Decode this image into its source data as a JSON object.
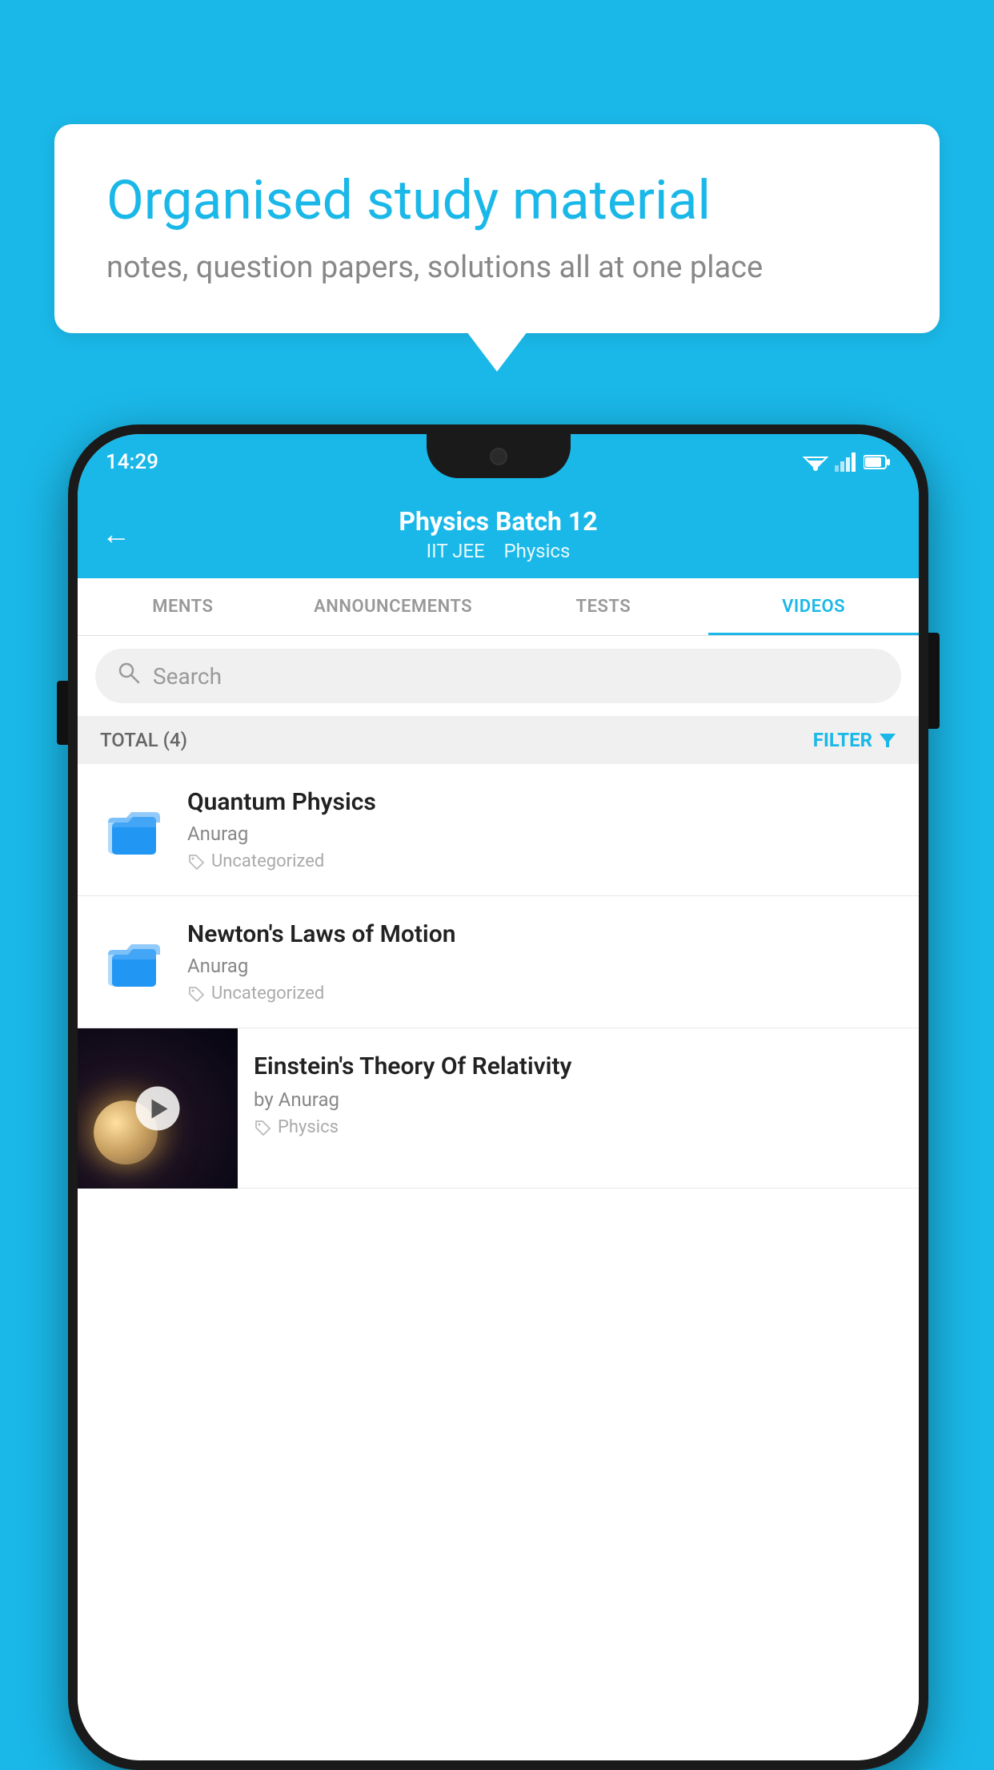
{
  "background_color": "#1ab8e8",
  "speech_bubble": {
    "title": "Organised study material",
    "subtitle": "notes, question papers, solutions all at one place"
  },
  "status_bar": {
    "time": "14:29",
    "wifi_icon": "wifi",
    "signal_icon": "signal",
    "battery_icon": "battery"
  },
  "app_header": {
    "back_label": "←",
    "title": "Physics Batch 12",
    "subtitle_part1": "IIT JEE",
    "subtitle_part2": "Physics"
  },
  "tabs": [
    {
      "label": "MENTS",
      "active": false
    },
    {
      "label": "ANNOUNCEMENTS",
      "active": false
    },
    {
      "label": "TESTS",
      "active": false
    },
    {
      "label": "VIDEOS",
      "active": true
    }
  ],
  "search": {
    "placeholder": "Search"
  },
  "filter_bar": {
    "total_label": "TOTAL (4)",
    "filter_label": "FILTER"
  },
  "videos": [
    {
      "title": "Quantum Physics",
      "author": "Anurag",
      "tag": "Uncategorized",
      "type": "folder"
    },
    {
      "title": "Newton's Laws of Motion",
      "author": "Anurag",
      "tag": "Uncategorized",
      "type": "folder"
    },
    {
      "title": "Einstein's Theory Of Relativity",
      "author": "by Anurag",
      "tag": "Physics",
      "type": "video"
    }
  ]
}
